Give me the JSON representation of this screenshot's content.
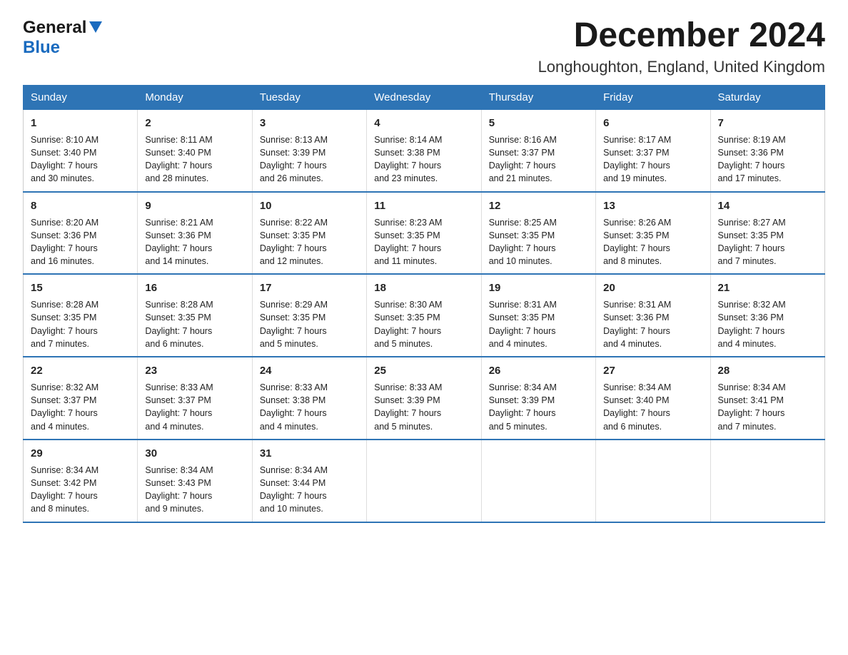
{
  "logo": {
    "general": "General",
    "blue": "Blue"
  },
  "title": "December 2024",
  "location": "Longhoughton, England, United Kingdom",
  "days_of_week": [
    "Sunday",
    "Monday",
    "Tuesday",
    "Wednesday",
    "Thursday",
    "Friday",
    "Saturday"
  ],
  "weeks": [
    [
      {
        "day": "1",
        "sunrise": "8:10 AM",
        "sunset": "3:40 PM",
        "daylight": "7 hours and 30 minutes."
      },
      {
        "day": "2",
        "sunrise": "8:11 AM",
        "sunset": "3:40 PM",
        "daylight": "7 hours and 28 minutes."
      },
      {
        "day": "3",
        "sunrise": "8:13 AM",
        "sunset": "3:39 PM",
        "daylight": "7 hours and 26 minutes."
      },
      {
        "day": "4",
        "sunrise": "8:14 AM",
        "sunset": "3:38 PM",
        "daylight": "7 hours and 23 minutes."
      },
      {
        "day": "5",
        "sunrise": "8:16 AM",
        "sunset": "3:37 PM",
        "daylight": "7 hours and 21 minutes."
      },
      {
        "day": "6",
        "sunrise": "8:17 AM",
        "sunset": "3:37 PM",
        "daylight": "7 hours and 19 minutes."
      },
      {
        "day": "7",
        "sunrise": "8:19 AM",
        "sunset": "3:36 PM",
        "daylight": "7 hours and 17 minutes."
      }
    ],
    [
      {
        "day": "8",
        "sunrise": "8:20 AM",
        "sunset": "3:36 PM",
        "daylight": "7 hours and 16 minutes."
      },
      {
        "day": "9",
        "sunrise": "8:21 AM",
        "sunset": "3:36 PM",
        "daylight": "7 hours and 14 minutes."
      },
      {
        "day": "10",
        "sunrise": "8:22 AM",
        "sunset": "3:35 PM",
        "daylight": "7 hours and 12 minutes."
      },
      {
        "day": "11",
        "sunrise": "8:23 AM",
        "sunset": "3:35 PM",
        "daylight": "7 hours and 11 minutes."
      },
      {
        "day": "12",
        "sunrise": "8:25 AM",
        "sunset": "3:35 PM",
        "daylight": "7 hours and 10 minutes."
      },
      {
        "day": "13",
        "sunrise": "8:26 AM",
        "sunset": "3:35 PM",
        "daylight": "7 hours and 8 minutes."
      },
      {
        "day": "14",
        "sunrise": "8:27 AM",
        "sunset": "3:35 PM",
        "daylight": "7 hours and 7 minutes."
      }
    ],
    [
      {
        "day": "15",
        "sunrise": "8:28 AM",
        "sunset": "3:35 PM",
        "daylight": "7 hours and 7 minutes."
      },
      {
        "day": "16",
        "sunrise": "8:28 AM",
        "sunset": "3:35 PM",
        "daylight": "7 hours and 6 minutes."
      },
      {
        "day": "17",
        "sunrise": "8:29 AM",
        "sunset": "3:35 PM",
        "daylight": "7 hours and 5 minutes."
      },
      {
        "day": "18",
        "sunrise": "8:30 AM",
        "sunset": "3:35 PM",
        "daylight": "7 hours and 5 minutes."
      },
      {
        "day": "19",
        "sunrise": "8:31 AM",
        "sunset": "3:35 PM",
        "daylight": "7 hours and 4 minutes."
      },
      {
        "day": "20",
        "sunrise": "8:31 AM",
        "sunset": "3:36 PM",
        "daylight": "7 hours and 4 minutes."
      },
      {
        "day": "21",
        "sunrise": "8:32 AM",
        "sunset": "3:36 PM",
        "daylight": "7 hours and 4 minutes."
      }
    ],
    [
      {
        "day": "22",
        "sunrise": "8:32 AM",
        "sunset": "3:37 PM",
        "daylight": "7 hours and 4 minutes."
      },
      {
        "day": "23",
        "sunrise": "8:33 AM",
        "sunset": "3:37 PM",
        "daylight": "7 hours and 4 minutes."
      },
      {
        "day": "24",
        "sunrise": "8:33 AM",
        "sunset": "3:38 PM",
        "daylight": "7 hours and 4 minutes."
      },
      {
        "day": "25",
        "sunrise": "8:33 AM",
        "sunset": "3:39 PM",
        "daylight": "7 hours and 5 minutes."
      },
      {
        "day": "26",
        "sunrise": "8:34 AM",
        "sunset": "3:39 PM",
        "daylight": "7 hours and 5 minutes."
      },
      {
        "day": "27",
        "sunrise": "8:34 AM",
        "sunset": "3:40 PM",
        "daylight": "7 hours and 6 minutes."
      },
      {
        "day": "28",
        "sunrise": "8:34 AM",
        "sunset": "3:41 PM",
        "daylight": "7 hours and 7 minutes."
      }
    ],
    [
      {
        "day": "29",
        "sunrise": "8:34 AM",
        "sunset": "3:42 PM",
        "daylight": "7 hours and 8 minutes."
      },
      {
        "day": "30",
        "sunrise": "8:34 AM",
        "sunset": "3:43 PM",
        "daylight": "7 hours and 9 minutes."
      },
      {
        "day": "31",
        "sunrise": "8:34 AM",
        "sunset": "3:44 PM",
        "daylight": "7 hours and 10 minutes."
      },
      null,
      null,
      null,
      null
    ]
  ]
}
